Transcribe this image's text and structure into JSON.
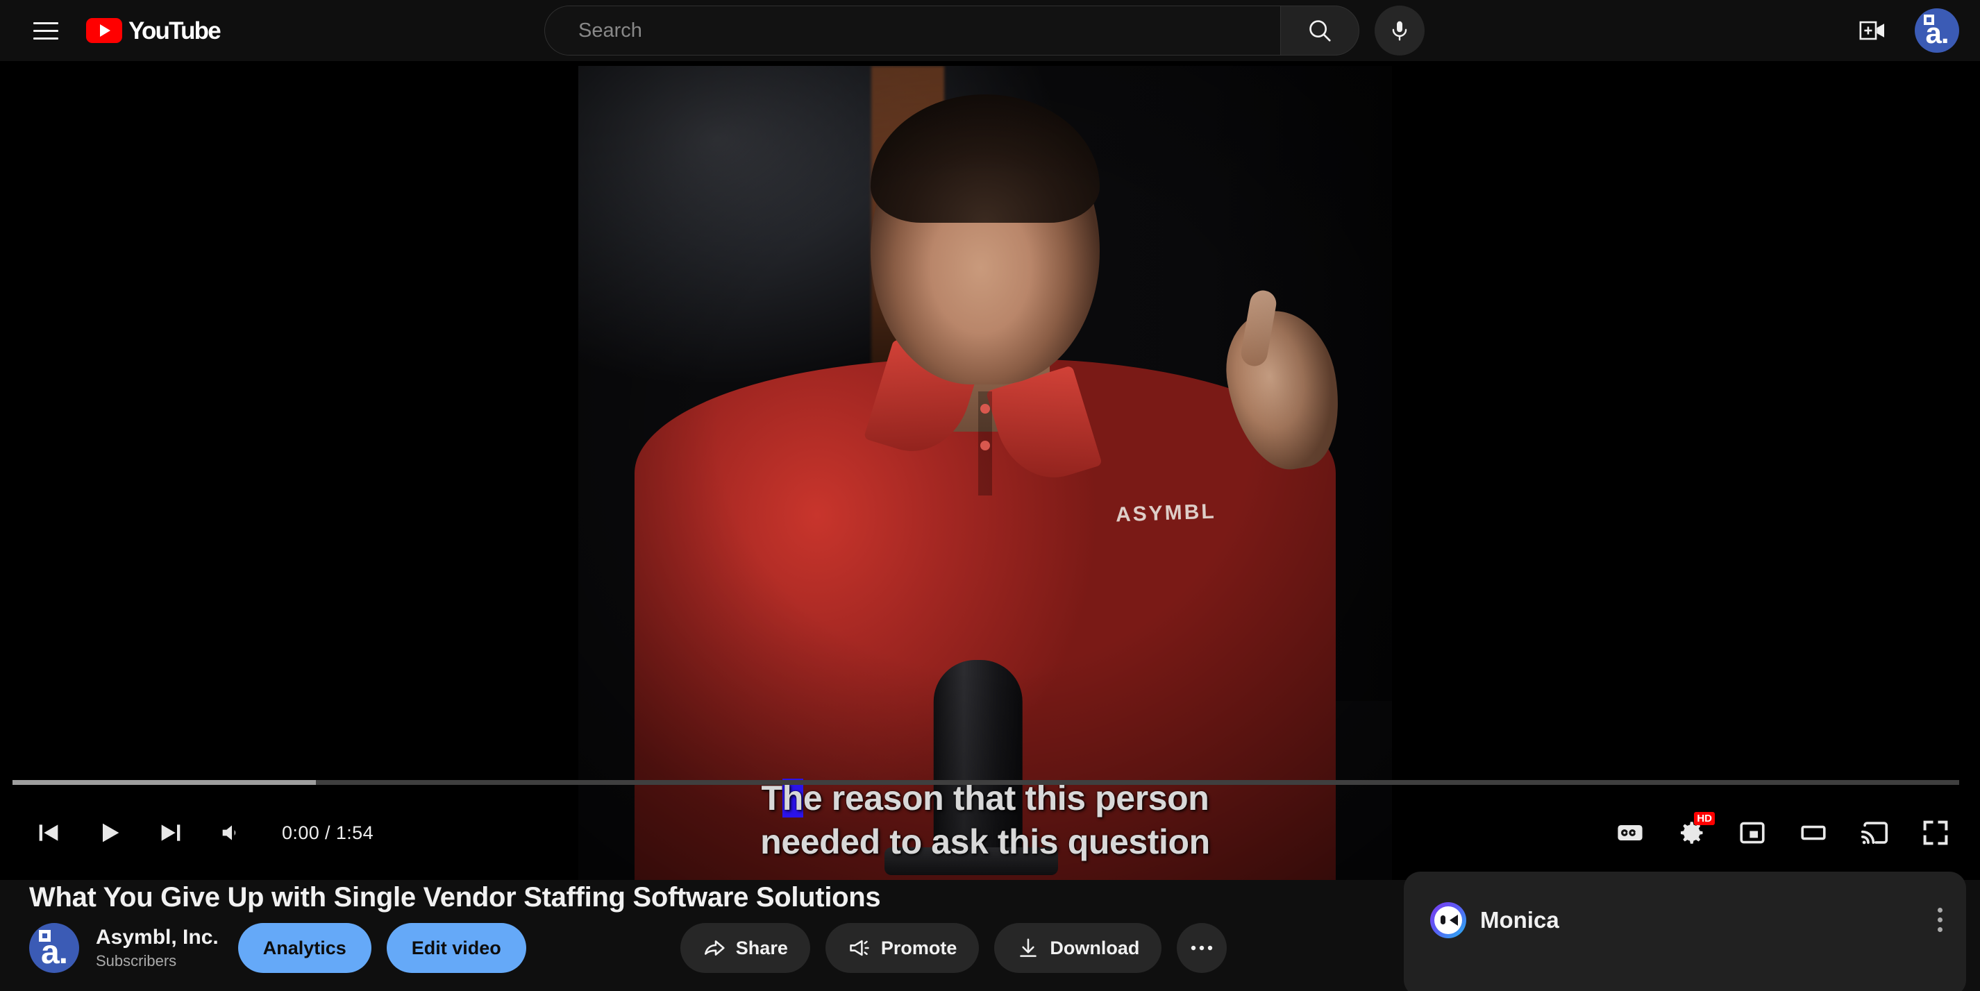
{
  "header": {
    "menu_label": "Guide menu",
    "logo_text": "YouTube",
    "search": {
      "placeholder": "Search",
      "value": ""
    },
    "search_button_label": "Search",
    "mic_button_label": "Search with your voice",
    "create_button_label": "Create",
    "avatar_label": "a."
  },
  "player": {
    "captions": {
      "line1_pre": "T",
      "line1_highlight": "h",
      "line1_post": "e reason that this person",
      "line2": "needed to ask this question"
    },
    "controls": {
      "previous_label": "Previous",
      "play_label": "Play",
      "next_label": "Next",
      "volume_label": "Mute",
      "time_current": "0:00",
      "time_separator": "/",
      "time_duration": "1:54",
      "time_display": "0:00 / 1:54",
      "subtitles_label": "Subtitles/closed captions (c)",
      "settings_label": "Settings",
      "quality_badge": "HD",
      "miniplayer_label": "Miniplayer (i)",
      "theater_label": "Theater mode (t)",
      "cast_label": "Play on TV",
      "fullscreen_label": "Full screen (f)"
    },
    "progress": {
      "played_percent": 0,
      "loaded_percent": 15.6
    }
  },
  "video": {
    "title": "What You Give Up with Single Vendor Staffing Software Solutions",
    "channel_name": "Asymbl, Inc.",
    "channel_subs": "Subscribers",
    "channel_avatar_label": "a.",
    "buttons": {
      "analytics": "Analytics",
      "edit_video": "Edit video",
      "share": "Share",
      "promote": "Promote",
      "download": "Download",
      "more": "..."
    }
  },
  "sidebar": {
    "monica": {
      "name": "Monica",
      "menu_label": "More options"
    }
  },
  "colors": {
    "brand_red": "#ff0000",
    "page_bg": "#0f0f0f",
    "surface": "#212121",
    "chip": "#272727",
    "accent_blue": "#65a9f8",
    "avatar_blue": "#3b5bb5",
    "caption_highlight": "#2b13ea",
    "text_primary": "#f1f1f1",
    "text_secondary": "#aaaaaa"
  }
}
